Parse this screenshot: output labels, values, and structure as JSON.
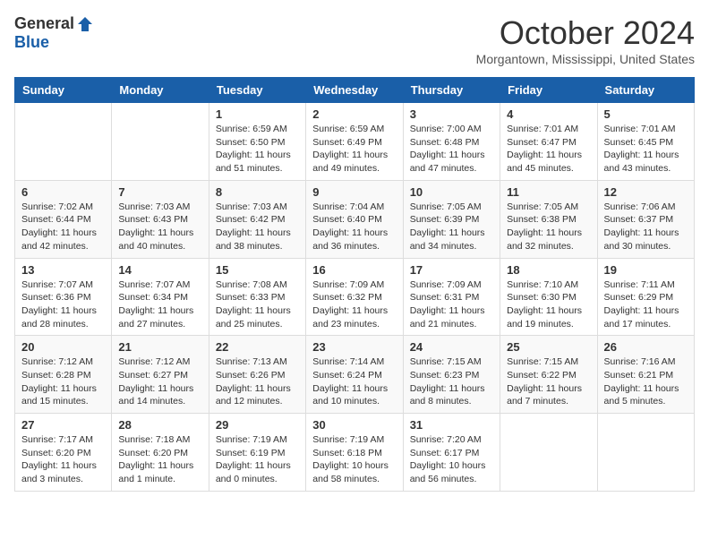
{
  "header": {
    "logo_general": "General",
    "logo_blue": "Blue",
    "month_title": "October 2024",
    "location": "Morgantown, Mississippi, United States"
  },
  "days_of_week": [
    "Sunday",
    "Monday",
    "Tuesday",
    "Wednesday",
    "Thursday",
    "Friday",
    "Saturday"
  ],
  "weeks": [
    [
      {
        "day": "",
        "info": ""
      },
      {
        "day": "",
        "info": ""
      },
      {
        "day": "1",
        "info": "Sunrise: 6:59 AM\nSunset: 6:50 PM\nDaylight: 11 hours and 51 minutes."
      },
      {
        "day": "2",
        "info": "Sunrise: 6:59 AM\nSunset: 6:49 PM\nDaylight: 11 hours and 49 minutes."
      },
      {
        "day": "3",
        "info": "Sunrise: 7:00 AM\nSunset: 6:48 PM\nDaylight: 11 hours and 47 minutes."
      },
      {
        "day": "4",
        "info": "Sunrise: 7:01 AM\nSunset: 6:47 PM\nDaylight: 11 hours and 45 minutes."
      },
      {
        "day": "5",
        "info": "Sunrise: 7:01 AM\nSunset: 6:45 PM\nDaylight: 11 hours and 43 minutes."
      }
    ],
    [
      {
        "day": "6",
        "info": "Sunrise: 7:02 AM\nSunset: 6:44 PM\nDaylight: 11 hours and 42 minutes."
      },
      {
        "day": "7",
        "info": "Sunrise: 7:03 AM\nSunset: 6:43 PM\nDaylight: 11 hours and 40 minutes."
      },
      {
        "day": "8",
        "info": "Sunrise: 7:03 AM\nSunset: 6:42 PM\nDaylight: 11 hours and 38 minutes."
      },
      {
        "day": "9",
        "info": "Sunrise: 7:04 AM\nSunset: 6:40 PM\nDaylight: 11 hours and 36 minutes."
      },
      {
        "day": "10",
        "info": "Sunrise: 7:05 AM\nSunset: 6:39 PM\nDaylight: 11 hours and 34 minutes."
      },
      {
        "day": "11",
        "info": "Sunrise: 7:05 AM\nSunset: 6:38 PM\nDaylight: 11 hours and 32 minutes."
      },
      {
        "day": "12",
        "info": "Sunrise: 7:06 AM\nSunset: 6:37 PM\nDaylight: 11 hours and 30 minutes."
      }
    ],
    [
      {
        "day": "13",
        "info": "Sunrise: 7:07 AM\nSunset: 6:36 PM\nDaylight: 11 hours and 28 minutes."
      },
      {
        "day": "14",
        "info": "Sunrise: 7:07 AM\nSunset: 6:34 PM\nDaylight: 11 hours and 27 minutes."
      },
      {
        "day": "15",
        "info": "Sunrise: 7:08 AM\nSunset: 6:33 PM\nDaylight: 11 hours and 25 minutes."
      },
      {
        "day": "16",
        "info": "Sunrise: 7:09 AM\nSunset: 6:32 PM\nDaylight: 11 hours and 23 minutes."
      },
      {
        "day": "17",
        "info": "Sunrise: 7:09 AM\nSunset: 6:31 PM\nDaylight: 11 hours and 21 minutes."
      },
      {
        "day": "18",
        "info": "Sunrise: 7:10 AM\nSunset: 6:30 PM\nDaylight: 11 hours and 19 minutes."
      },
      {
        "day": "19",
        "info": "Sunrise: 7:11 AM\nSunset: 6:29 PM\nDaylight: 11 hours and 17 minutes."
      }
    ],
    [
      {
        "day": "20",
        "info": "Sunrise: 7:12 AM\nSunset: 6:28 PM\nDaylight: 11 hours and 15 minutes."
      },
      {
        "day": "21",
        "info": "Sunrise: 7:12 AM\nSunset: 6:27 PM\nDaylight: 11 hours and 14 minutes."
      },
      {
        "day": "22",
        "info": "Sunrise: 7:13 AM\nSunset: 6:26 PM\nDaylight: 11 hours and 12 minutes."
      },
      {
        "day": "23",
        "info": "Sunrise: 7:14 AM\nSunset: 6:24 PM\nDaylight: 11 hours and 10 minutes."
      },
      {
        "day": "24",
        "info": "Sunrise: 7:15 AM\nSunset: 6:23 PM\nDaylight: 11 hours and 8 minutes."
      },
      {
        "day": "25",
        "info": "Sunrise: 7:15 AM\nSunset: 6:22 PM\nDaylight: 11 hours and 7 minutes."
      },
      {
        "day": "26",
        "info": "Sunrise: 7:16 AM\nSunset: 6:21 PM\nDaylight: 11 hours and 5 minutes."
      }
    ],
    [
      {
        "day": "27",
        "info": "Sunrise: 7:17 AM\nSunset: 6:20 PM\nDaylight: 11 hours and 3 minutes."
      },
      {
        "day": "28",
        "info": "Sunrise: 7:18 AM\nSunset: 6:20 PM\nDaylight: 11 hours and 1 minute."
      },
      {
        "day": "29",
        "info": "Sunrise: 7:19 AM\nSunset: 6:19 PM\nDaylight: 11 hours and 0 minutes."
      },
      {
        "day": "30",
        "info": "Sunrise: 7:19 AM\nSunset: 6:18 PM\nDaylight: 10 hours and 58 minutes."
      },
      {
        "day": "31",
        "info": "Sunrise: 7:20 AM\nSunset: 6:17 PM\nDaylight: 10 hours and 56 minutes."
      },
      {
        "day": "",
        "info": ""
      },
      {
        "day": "",
        "info": ""
      }
    ]
  ]
}
